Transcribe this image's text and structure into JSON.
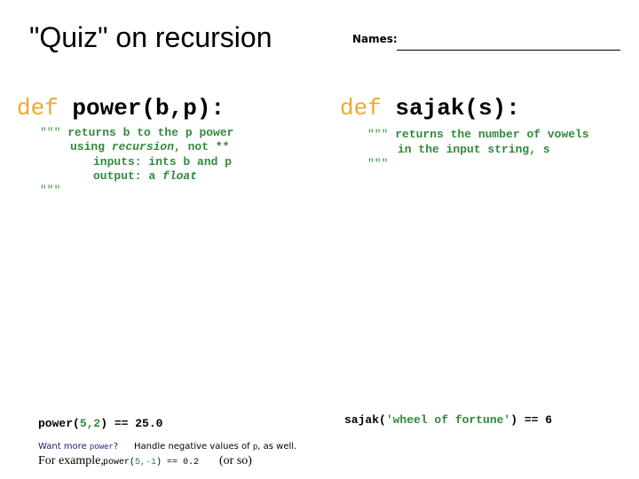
{
  "header": {
    "title": "\"Quiz\" on recursion",
    "names_label": "Names:"
  },
  "left": {
    "def_keyword": "def",
    "signature": "power(b,p):",
    "docstring": {
      "open_quotes": "\"\"\"",
      "line1": "returns b to the p power",
      "line2_pre": "using ",
      "line2_em": "recursion",
      "line2_post": ", not **",
      "line3": "inputs: ints b and p",
      "line4_pre": "output: a ",
      "line4_em": "float",
      "close_quotes": "\"\"\""
    },
    "example": {
      "call_pre": "power(",
      "args": "5,2",
      "call_post": ")",
      "op": " == ",
      "result": "25.0"
    },
    "extra": {
      "want_more_pre": "Want more ",
      "want_more_code": "power",
      "want_more_post": "?",
      "handle_pre": "Handle negative values of ",
      "handle_code": "p",
      "handle_post": ", as well.",
      "for_example": "For example,",
      "ex_call_pre": "power(",
      "ex_args": "5,-1",
      "ex_call_post": ")",
      "ex_op": " == ",
      "ex_result": "0.2",
      "or_so": "(or so)"
    }
  },
  "right": {
    "def_keyword": "def",
    "signature": "sajak(s):",
    "docstring": {
      "open_quotes": "\"\"\"",
      "line1": "returns the number of vowels",
      "line2": "in the input string, s",
      "close_quotes": "\"\"\""
    },
    "example": {
      "call_pre": "sajak(",
      "arg": "'wheel of fortune'",
      "call_post": ")",
      "op": " == ",
      "result": "6"
    }
  },
  "colors": {
    "keyword": "#f0a830",
    "docstring": "#2f8a3c",
    "note_blue": "#1c1c7a"
  }
}
